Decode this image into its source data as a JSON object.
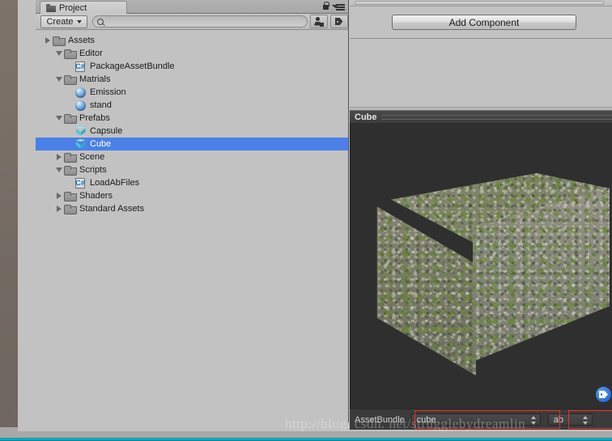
{
  "project_panel": {
    "tab_label": "Project",
    "tab_icon": "folder-icon",
    "lock_icon": "lock-icon",
    "menu_icon": "hamburger-menu-icon",
    "create_label": "Create",
    "search_value": "",
    "search_placeholder": "",
    "search_icon": "search-icon",
    "filter_by_type_icon": "filter-by-type-icon",
    "filter_by_label_icon": "filter-by-label-icon",
    "tree": [
      {
        "label": "Assets",
        "icon": "folder-icon",
        "indent": 0,
        "arrow": "closed",
        "selected": false
      },
      {
        "label": "Editor",
        "icon": "folder-icon",
        "indent": 1,
        "arrow": "open",
        "selected": false
      },
      {
        "label": "PackageAssetBundle",
        "icon": "csharp-script-icon",
        "indent": 2,
        "arrow": "none",
        "selected": false
      },
      {
        "label": "Matrials",
        "icon": "folder-icon",
        "indent": 1,
        "arrow": "open",
        "selected": false
      },
      {
        "label": "Emission",
        "icon": "material-icon",
        "indent": 2,
        "arrow": "none",
        "selected": false
      },
      {
        "label": "stand",
        "icon": "material-icon",
        "indent": 2,
        "arrow": "none",
        "selected": false
      },
      {
        "label": "Prefabs",
        "icon": "folder-icon",
        "indent": 1,
        "arrow": "open",
        "selected": false
      },
      {
        "label": "Capsule",
        "icon": "prefab-icon",
        "indent": 2,
        "arrow": "none",
        "selected": false
      },
      {
        "label": "Cube",
        "icon": "prefab-icon",
        "indent": 2,
        "arrow": "none",
        "selected": true
      },
      {
        "label": "Scene",
        "icon": "folder-icon",
        "indent": 1,
        "arrow": "closed",
        "selected": false
      },
      {
        "label": "Scripts",
        "icon": "folder-icon",
        "indent": 1,
        "arrow": "open",
        "selected": false
      },
      {
        "label": "LoadAbFiles",
        "icon": "csharp-script-icon",
        "indent": 2,
        "arrow": "none",
        "selected": false
      },
      {
        "label": "Shaders",
        "icon": "folder-icon",
        "indent": 1,
        "arrow": "closed",
        "selected": false
      },
      {
        "label": "Standard Assets",
        "icon": "folder-icon",
        "indent": 1,
        "arrow": "closed",
        "selected": false
      }
    ]
  },
  "inspector": {
    "add_component_label": "Add Component",
    "preview": {
      "title": "Cube",
      "toolbar_icon": "asset-label-tag-icon"
    },
    "assetbundle": {
      "label": "AssetBundle",
      "name_value": "cube",
      "variant_value": "ab",
      "dropdown_icon": "updown-spinner-icon"
    }
  },
  "colors": {
    "selection_blue": "#4a80e8",
    "highlight_red": "#ef2d24",
    "panel_gray": "#c2c2c2",
    "preview_bg": "#2f2f2f",
    "assetbundle_bar": "#3b3b3b"
  },
  "watermark": "http://blog. csdn. net/strugglebydreamlin"
}
